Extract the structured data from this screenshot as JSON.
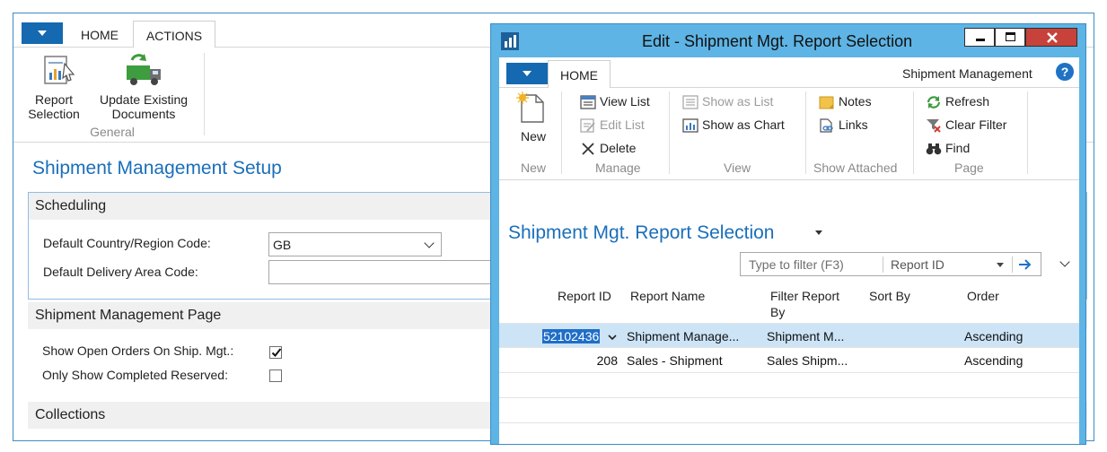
{
  "background_window": {
    "tabs": [
      "HOME",
      "ACTIONS"
    ],
    "ribbon": {
      "report_selection_label": [
        "Report",
        "Selection"
      ],
      "update_docs_label": [
        "Update Existing",
        "Documents"
      ],
      "group_label": "General"
    },
    "page_title": "Shipment Management Setup",
    "sections": {
      "scheduling": {
        "header": "Scheduling",
        "default_country_label": "Default Country/Region Code:",
        "default_country_value": "GB",
        "default_delivery_label": "Default Delivery Area Code:",
        "default_delivery_value": ""
      },
      "shipment_page": {
        "header": "Shipment Management Page",
        "show_open_orders_label": "Show Open Orders On Ship. Mgt.:",
        "show_open_orders_checked": true,
        "only_completed_label": "Only Show Completed Reserved:",
        "only_completed_checked": false
      },
      "collections": {
        "header": "Collections"
      }
    }
  },
  "dialog": {
    "title": "Edit - Shipment Mgt. Report Selection",
    "home_tab": "HOME",
    "context_label": "Shipment Management",
    "ribbon": {
      "new_group": {
        "new_label": "New",
        "group_label": "New"
      },
      "manage_group": {
        "view_list": "View List",
        "edit_list": "Edit List",
        "delete": "Delete",
        "group_label": "Manage"
      },
      "view_group": {
        "show_as_list": "Show as List",
        "show_as_chart": "Show as Chart",
        "group_label": "View"
      },
      "show_attached_group": {
        "notes": "Notes",
        "links": "Links",
        "group_label": "Show Attached"
      },
      "page_group": {
        "refresh": "Refresh",
        "clear_filter": "Clear Filter",
        "find": "Find",
        "group_label": "Page"
      }
    },
    "list_title": "Shipment Mgt. Report Selection",
    "filter": {
      "placeholder": "Type to filter (F3)",
      "field": "Report ID"
    },
    "columns": {
      "report_id": "Report ID",
      "report_name": "Report Name",
      "filter_report_by": [
        "Filter Report",
        "By"
      ],
      "sort_by": "Sort By",
      "order": "Order"
    },
    "rows": [
      {
        "report_id": "52102436",
        "report_name": "Shipment Manage...",
        "filter_report_by": "Shipment M...",
        "sort_by": "",
        "order": "Ascending"
      },
      {
        "report_id": "208",
        "report_name": "Sales - Shipment",
        "filter_report_by": "Sales Shipm...",
        "sort_by": "",
        "order": "Ascending"
      }
    ],
    "accent_color": "#1a6fba",
    "title_bar_color": "#5eb4e4",
    "close_button_color": "#c7423a"
  }
}
